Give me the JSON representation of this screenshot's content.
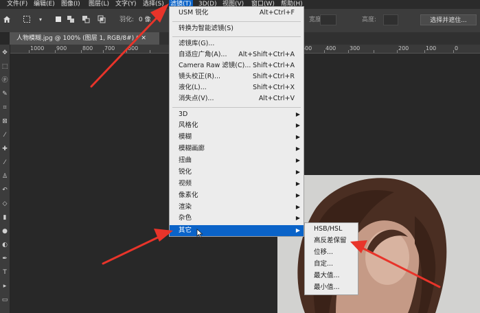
{
  "menubar": {
    "items": [
      "文件(F)",
      "编辑(E)",
      "图像(I)",
      "图层(L)",
      "文字(Y)",
      "选择(S)",
      "滤镜(T)",
      "3D(D)",
      "视图(V)",
      "窗口(W)",
      "帮助(H)"
    ],
    "active_index": 6
  },
  "options": {
    "feather_label": "羽化:",
    "feather_value": "0 像",
    "width_label": "宽度:",
    "height_label": "高度:",
    "select_mask_button": "选择并遮住..."
  },
  "document_tab": {
    "title": "人物模糊.jpg @ 100% (图层 1, RGB/8#) * ✕"
  },
  "ruler": {
    "labels": [
      "1000",
      "900",
      "800",
      "700",
      "600",
      "500",
      "400",
      "300",
      "200",
      "100",
      "0"
    ]
  },
  "filter_menu": {
    "items": [
      {
        "label": "USM 锐化",
        "shortcut": "Alt+Ctrl+F"
      },
      {
        "label": "转换为智能滤镜(S)"
      },
      {
        "label": "滤镜库(G)..."
      },
      {
        "label": "自适应广角(A)...",
        "shortcut": "Alt+Shift+Ctrl+A"
      },
      {
        "label": "Camera Raw 滤镜(C)...",
        "shortcut": "Shift+Ctrl+A"
      },
      {
        "label": "镜头校正(R)...",
        "shortcut": "Shift+Ctrl+R"
      },
      {
        "label": "液化(L)...",
        "shortcut": "Shift+Ctrl+X"
      },
      {
        "label": "消失点(V)...",
        "shortcut": "Alt+Ctrl+V"
      },
      {
        "label": "3D"
      },
      {
        "label": "风格化"
      },
      {
        "label": "模糊"
      },
      {
        "label": "模糊画廊"
      },
      {
        "label": "扭曲"
      },
      {
        "label": "锐化"
      },
      {
        "label": "视频"
      },
      {
        "label": "像素化"
      },
      {
        "label": "渲染"
      },
      {
        "label": "杂色"
      },
      {
        "label": "其它"
      }
    ]
  },
  "other_submenu": {
    "items": [
      "HSB/HSL",
      "高反差保留",
      "位移...",
      "自定...",
      "最大值...",
      "最小值..."
    ]
  },
  "colors": {
    "highlight": "#0a63c8",
    "annotation_arrow": "#e8342a"
  }
}
